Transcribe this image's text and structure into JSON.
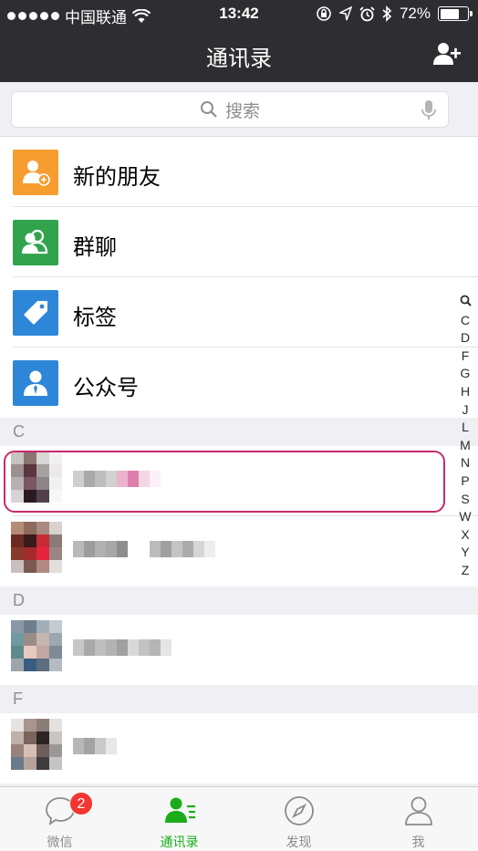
{
  "status_bar": {
    "carrier": "中国联通",
    "time": "13:42",
    "battery": "72%",
    "battery_level": 0.72,
    "icons": [
      "signal-dots-icon",
      "wifi-icon",
      "rotation-lock-icon",
      "location-icon",
      "alarm-icon",
      "bluetooth-icon",
      "battery-icon"
    ]
  },
  "nav": {
    "title": "通讯录",
    "add_friend_icon": "add-user-icon"
  },
  "search": {
    "placeholder": "搜索",
    "icon": "search-icon",
    "mic_icon": "microphone-icon"
  },
  "functions": [
    {
      "label": "新的朋友",
      "icon": "new-friends-icon",
      "color": "#f79c2e"
    },
    {
      "label": "群聊",
      "icon": "group-chat-icon",
      "color": "#31a34d"
    },
    {
      "label": "标签",
      "icon": "tag-icon",
      "color": "#2e86d8"
    },
    {
      "label": "公众号",
      "icon": "official-account-icon",
      "color": "#2e86d8"
    }
  ],
  "sections": [
    {
      "letter": "C"
    },
    {
      "letter": "D"
    },
    {
      "letter": "F"
    }
  ],
  "index": [
    "C",
    "D",
    "F",
    "G",
    "H",
    "J",
    "L",
    "M",
    "N",
    "P",
    "S",
    "W",
    "X",
    "Y",
    "Z"
  ],
  "tabs": [
    {
      "label": "微信",
      "icon": "chat-bubble-icon",
      "badge": "2"
    },
    {
      "label": "通讯录",
      "icon": "contacts-icon",
      "active": true
    },
    {
      "label": "发现",
      "icon": "compass-icon"
    },
    {
      "label": "我",
      "icon": "profile-icon"
    }
  ],
  "colors": {
    "nav_bg": "#2e2e32",
    "accent": "#1aad19",
    "badge": "#f43530",
    "highlight": "#c62a6b"
  }
}
